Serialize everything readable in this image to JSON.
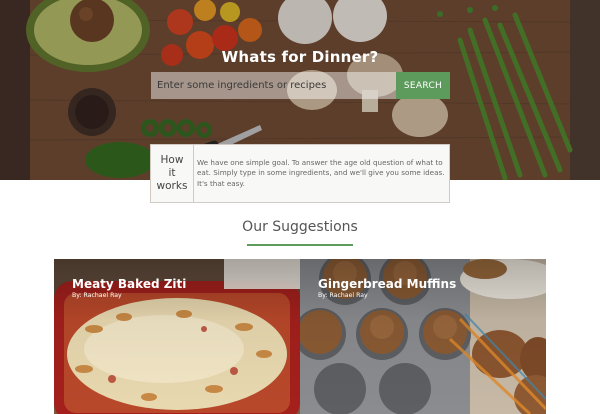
{
  "hero": {
    "title": "Whats for Dinner?",
    "search": {
      "placeholder": "Enter some ingredients or recipes",
      "value": "",
      "button_label": "SEARCH"
    }
  },
  "how_it_works": {
    "label_lines": [
      "How",
      "it",
      "works"
    ],
    "text": "We have one simple goal. To answer the age old question of what to eat. Simply type in some ingredients, and we'll give you some ideas. It's that easy."
  },
  "suggestions": {
    "title": "Our Suggestions",
    "cards": [
      {
        "title": "Meaty Baked Ziti",
        "byline": "By: Rachael Ray"
      },
      {
        "title": "Gingerbread Muffins",
        "byline": "By: Rachael Ray"
      }
    ]
  },
  "colors": {
    "accent_green": "#5d9b5d",
    "box_border": "#cfcac2",
    "hero_wood": "#6b4a34"
  },
  "icons": {
    "hero_background": "vegetables-on-cutting-board-photo",
    "card_1_image": "baked-ziti-photo",
    "card_2_image": "gingerbread-muffins-photo"
  }
}
